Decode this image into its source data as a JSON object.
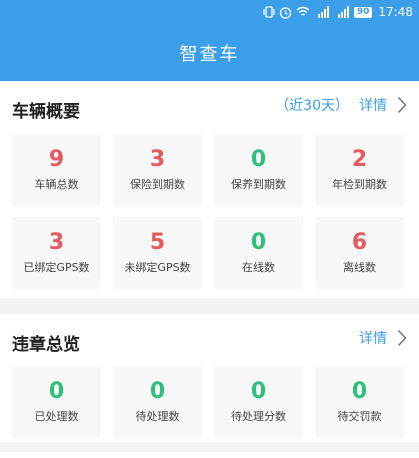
{
  "status_bar": {
    "time": "17:48",
    "battery": "90"
  },
  "app": {
    "title": "智查车"
  },
  "vehicle_overview": {
    "title": "车辆概要",
    "range": "（近30天）",
    "details": "详情",
    "stats": [
      {
        "value": "9",
        "label": "车辆总数",
        "color": "#e45a5f"
      },
      {
        "value": "3",
        "label": "保险到期数",
        "color": "#e45a5f"
      },
      {
        "value": "0",
        "label": "保养到期数",
        "color": "#2fbf7c"
      },
      {
        "value": "2",
        "label": "年检到期数",
        "color": "#e45a5f"
      },
      {
        "value": "3",
        "label": "已绑定GPS数",
        "color": "#e45a5f"
      },
      {
        "value": "5",
        "label": "未绑定GPS数",
        "color": "#e45a5f"
      },
      {
        "value": "0",
        "label": "在线数",
        "color": "#2fbf7c"
      },
      {
        "value": "6",
        "label": "离线数",
        "color": "#e45a5f"
      }
    ]
  },
  "violations": {
    "title": "违章总览",
    "details": "详情",
    "stats": [
      {
        "value": "0",
        "label": "已处理数",
        "color": "#2fbf7c"
      },
      {
        "value": "0",
        "label": "待处理数",
        "color": "#2fbf7c"
      },
      {
        "value": "0",
        "label": "待处理分数",
        "color": "#2fbf7c"
      },
      {
        "value": "0",
        "label": "待交罚款",
        "color": "#2fbf7c"
      }
    ]
  }
}
